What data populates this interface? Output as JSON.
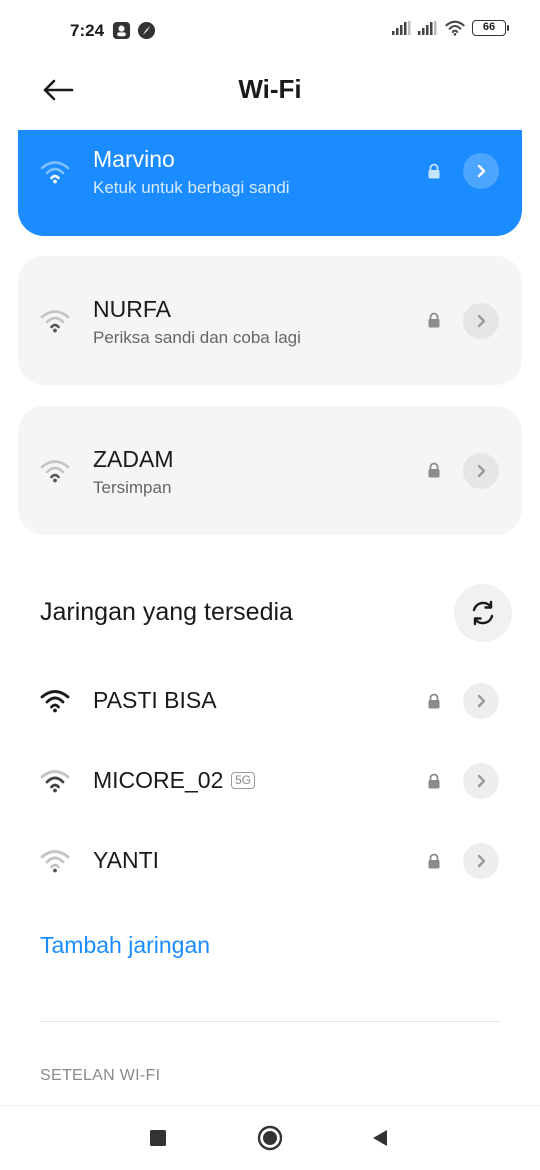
{
  "status_bar": {
    "time": "7:24",
    "battery": "66"
  },
  "header": {
    "title": "Wi-Fi"
  },
  "saved_networks": [
    {
      "name": "Marvino",
      "subtitle": "Ketuk untuk berbagi sandi",
      "state": "connected",
      "secured": true
    },
    {
      "name": "NURFA",
      "subtitle": "Periksa sandi dan coba lagi",
      "state": "error",
      "secured": true
    },
    {
      "name": "ZADAM",
      "subtitle": "Tersimpan",
      "state": "saved",
      "secured": true
    }
  ],
  "available": {
    "title": "Jaringan yang tersedia",
    "networks": [
      {
        "name": "PASTI BISA",
        "badge": "",
        "signal": "strong",
        "secured": true
      },
      {
        "name": "MICORE_02",
        "badge": "5G",
        "signal": "medium",
        "secured": true
      },
      {
        "name": "YANTI",
        "badge": "",
        "signal": "weak",
        "secured": true
      }
    ]
  },
  "add_network": "Tambah jaringan",
  "settings_section": "SETELAN WI-FI",
  "colors": {
    "accent": "#1a8cff",
    "card": "#f5f5f5",
    "text": "#1a1a1a",
    "subtext": "#666666"
  },
  "icons": {
    "back": "arrow-left-icon",
    "wifi": "wifi-icon",
    "lock": "lock-icon",
    "chevron": "chevron-right-icon",
    "refresh": "refresh-icon",
    "nav_recents": "square-icon",
    "nav_home": "circle-icon",
    "nav_back": "triangle-back-icon"
  }
}
